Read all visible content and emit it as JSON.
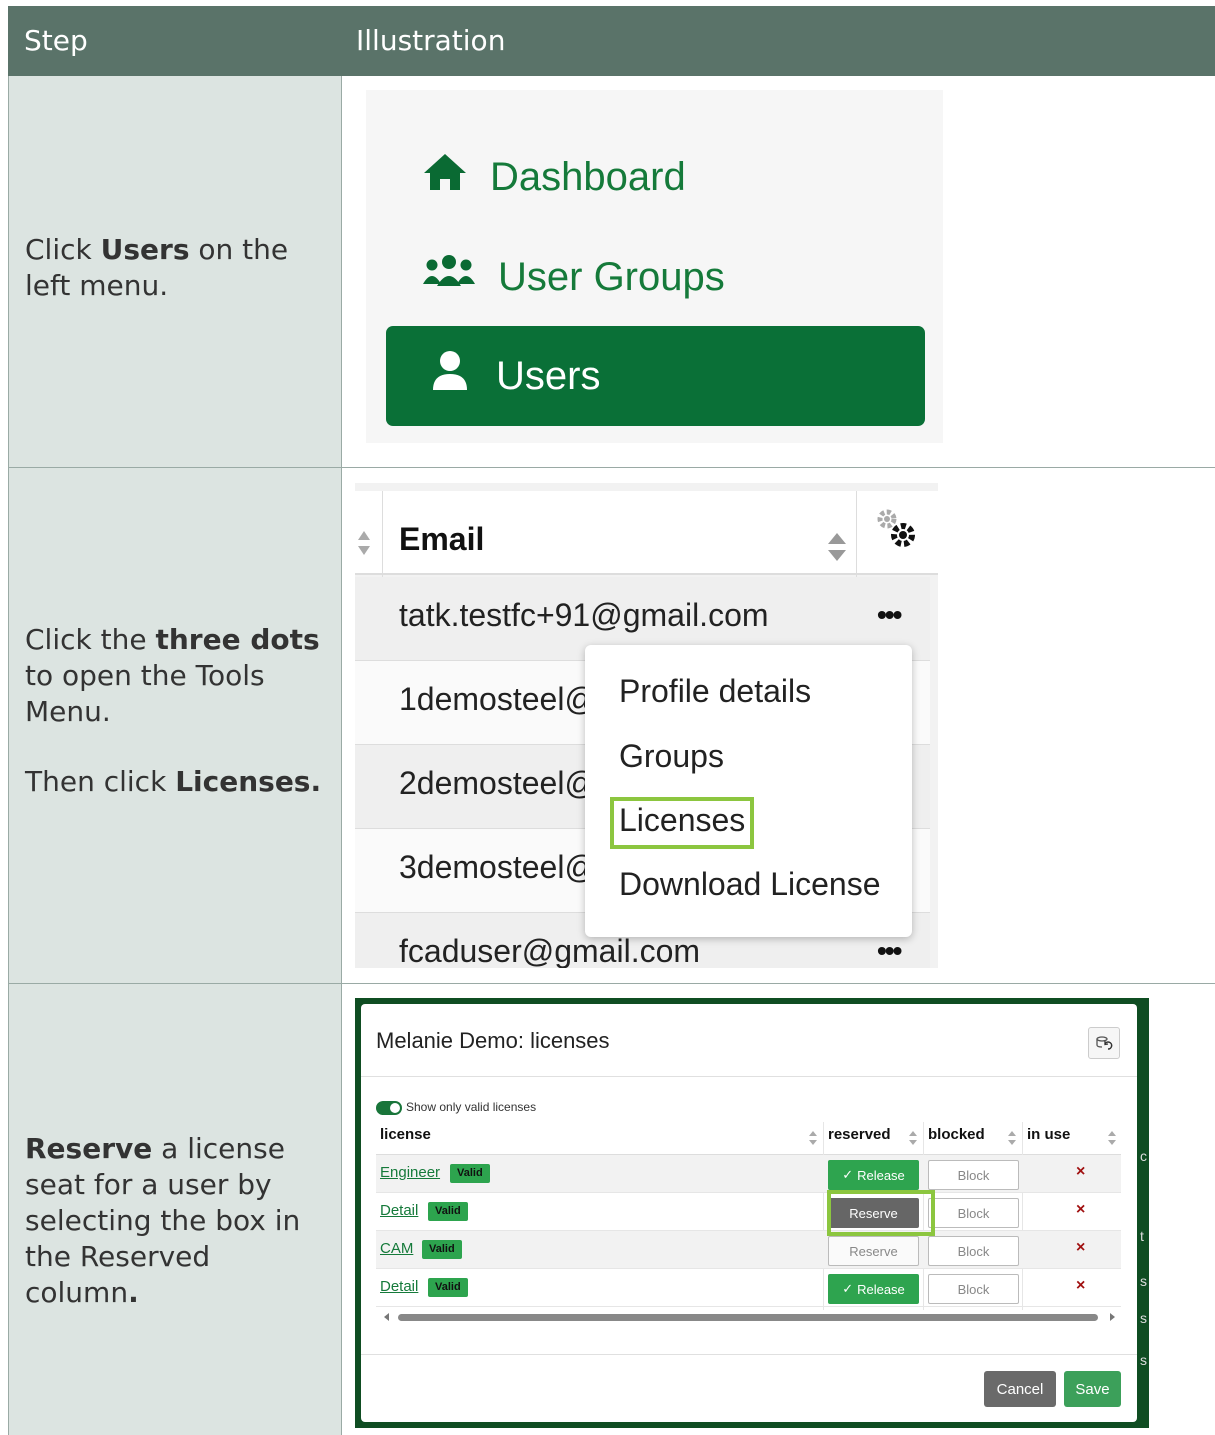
{
  "header": {
    "step": "Step",
    "illustration": "Illustration"
  },
  "steps": [
    {
      "pre": "Click ",
      "bold": "Users",
      "post": " on the left menu."
    },
    {
      "pre": "Click the ",
      "bold": "three dots",
      "post": " to open the Tools Menu.",
      "pre2": "Then click ",
      "bold2": "Licenses."
    },
    {
      "bold": "Reserve",
      "post": " a license seat for a user by selecting the box in the Reserved column",
      "dot": "."
    }
  ],
  "menu_panel": {
    "items": [
      {
        "label": "Dashboard",
        "icon": "home-icon"
      },
      {
        "label": "User Groups",
        "icon": "user-groups-icon"
      },
      {
        "label": "Users",
        "icon": "user-icon",
        "active": true
      }
    ],
    "accent": "#0a7037"
  },
  "users_panel": {
    "column": "Email",
    "rows": [
      "tatk.testfc+91@gmail.com",
      "1demosteel@",
      "2demosteel@",
      "3demosteel@",
      "fcaduser@gmail.com"
    ],
    "dots": "•••",
    "tools_menu": [
      "Profile details",
      "Groups",
      "Licenses",
      "Download License"
    ],
    "highlight": "#8cc63f"
  },
  "licenses_modal": {
    "title": "Melanie Demo: licenses",
    "toggle_label": "Show only valid licenses",
    "columns": [
      "license",
      "reserved",
      "blocked",
      "in use"
    ],
    "rows": [
      {
        "license": "Engineer",
        "badge": "Valid",
        "reserved": "Release",
        "blocked": "Block",
        "in_use": "×"
      },
      {
        "license": "Detail",
        "badge": "Valid",
        "reserved": "Reserve",
        "blocked": "Block",
        "in_use": "×"
      },
      {
        "license": "CAM",
        "badge": "Valid",
        "reserved": "Reserve",
        "blocked": "Block",
        "in_use": "×"
      },
      {
        "license": "Detail",
        "badge": "Valid",
        "reserved": "Release",
        "blocked": "Block",
        "in_use": "×"
      }
    ],
    "cancel": "Cancel",
    "save": "Save",
    "check": "✓"
  }
}
